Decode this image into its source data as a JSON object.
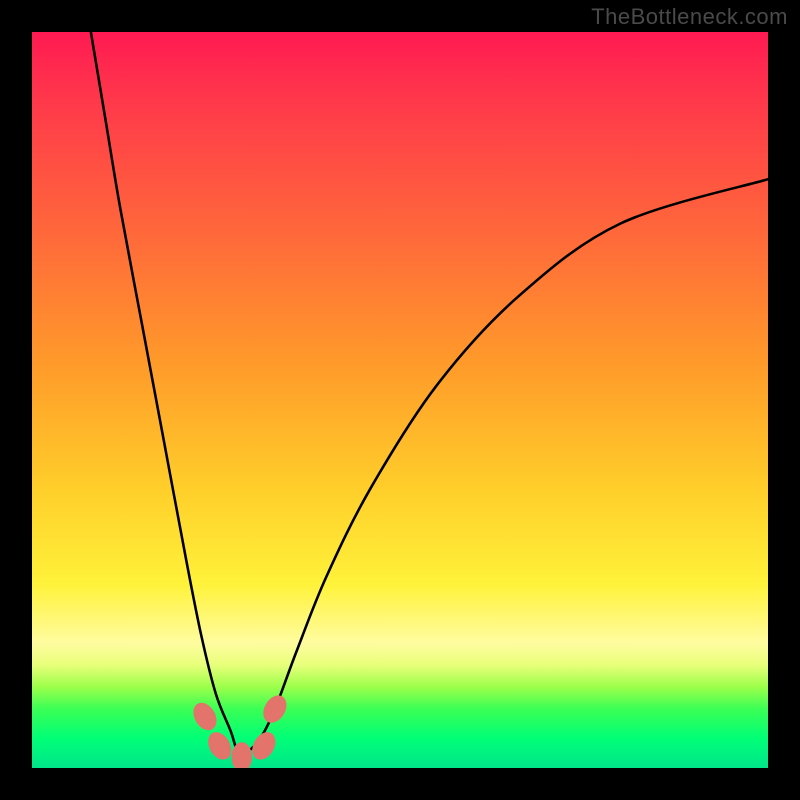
{
  "watermark": {
    "text": "TheBottleneck.com"
  },
  "chart_data": {
    "type": "line",
    "title": "",
    "xlabel": "",
    "ylabel": "",
    "xlim": [
      0,
      100
    ],
    "ylim": [
      0,
      100
    ],
    "legend": false,
    "grid": false,
    "background_gradient": {
      "direction": "vertical",
      "stops": [
        {
          "pos": 0,
          "color": "#ff1a52"
        },
        {
          "pos": 45,
          "color": "#ff9a2a"
        },
        {
          "pos": 75,
          "color": "#fff23a"
        },
        {
          "pos": 88,
          "color": "#9cff4a"
        },
        {
          "pos": 100,
          "color": "#00e58a"
        }
      ]
    },
    "series": [
      {
        "name": "bottleneck-curve",
        "type": "line",
        "x": [
          8,
          10,
          12,
          15,
          18,
          21,
          23,
          25,
          27,
          28,
          29,
          31,
          33,
          36,
          40,
          46,
          55,
          66,
          80,
          100
        ],
        "y": [
          100,
          88,
          76,
          60,
          44,
          28,
          18,
          10,
          5,
          2,
          2,
          4,
          8,
          16,
          26,
          38,
          52,
          64,
          74,
          80
        ]
      }
    ],
    "markers": [
      {
        "name": "valley-marker",
        "x": 23.5,
        "y": 7
      },
      {
        "name": "valley-marker",
        "x": 25.5,
        "y": 3
      },
      {
        "name": "valley-marker",
        "x": 28.5,
        "y": 1.5
      },
      {
        "name": "valley-marker",
        "x": 31.5,
        "y": 3
      },
      {
        "name": "valley-marker",
        "x": 33.0,
        "y": 8
      }
    ]
  }
}
